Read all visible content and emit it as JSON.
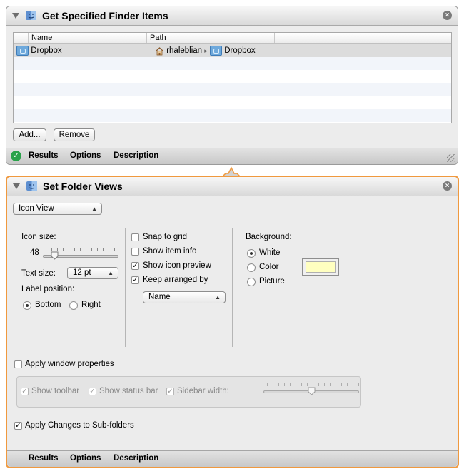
{
  "action1": {
    "title": "Get Specified Finder Items",
    "columns": [
      "Name",
      "Path"
    ],
    "rows": [
      {
        "name": "Dropbox",
        "path_user": "rhaleblian",
        "path_sep": "▸",
        "path_folder": "Dropbox"
      }
    ],
    "add_label": "Add...",
    "remove_label": "Remove",
    "footer": {
      "results": "Results",
      "options": "Options",
      "description": "Description"
    }
  },
  "action2": {
    "title": "Set Folder Views",
    "view_popup": "Icon View",
    "icon_size_label": "Icon size:",
    "icon_size_value": "48",
    "icon_size_slider_fraction": 0.12,
    "text_size_label": "Text size:",
    "text_size_value": "12 pt",
    "label_position_label": "Label position:",
    "label_bottom": "Bottom",
    "label_right": "Right",
    "label_position_selected": "Bottom",
    "snap_to_grid": {
      "label": "Snap to grid",
      "checked": false
    },
    "show_item_info": {
      "label": "Show item info",
      "checked": false
    },
    "show_icon_preview": {
      "label": "Show icon preview",
      "checked": true
    },
    "keep_arranged_by": {
      "label": "Keep arranged by",
      "checked": true
    },
    "arrange_popup": "Name",
    "background_label": "Background:",
    "bg_white": "White",
    "bg_color": "Color",
    "bg_picture": "Picture",
    "background_selected": "White",
    "swatch_color": "#ffffc0",
    "apply_window_properties": {
      "label": "Apply window properties",
      "checked": false
    },
    "show_toolbar": "Show toolbar",
    "show_status_bar": "Show status bar",
    "sidebar_width": "Sidebar width:",
    "sidebar_width_fraction": 0.5,
    "apply_subfolders": {
      "label": "Apply Changes to Sub-folders",
      "checked": true
    },
    "footer": {
      "results": "Results",
      "options": "Options",
      "description": "Description"
    }
  },
  "colors": {
    "selection_border": "#f0993e",
    "success": "#2aa24a"
  }
}
